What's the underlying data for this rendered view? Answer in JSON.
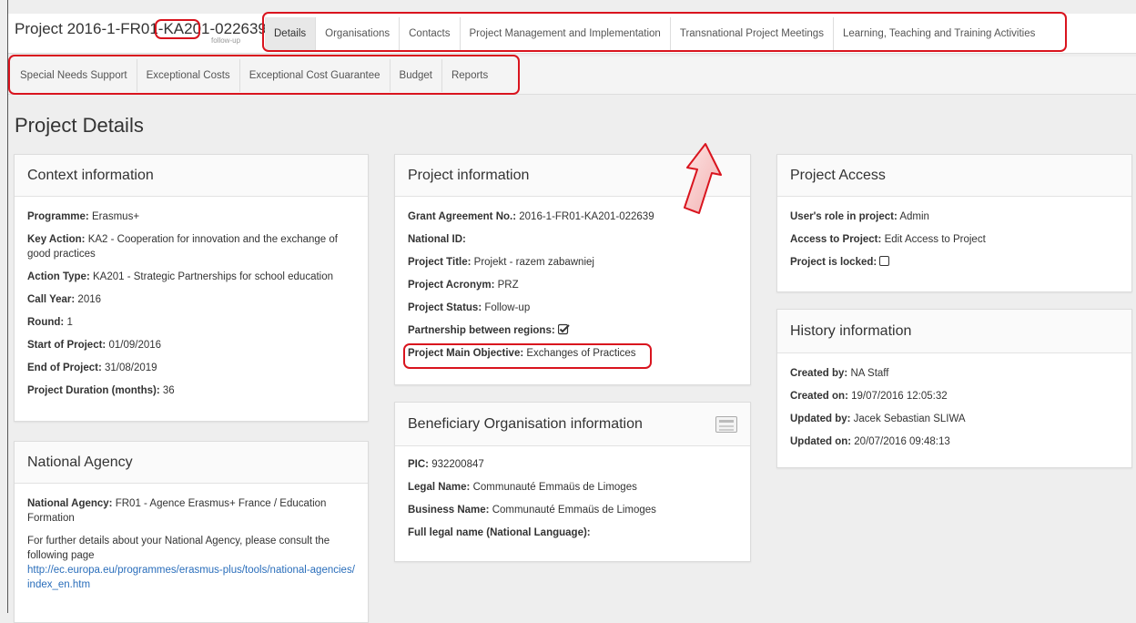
{
  "header": {
    "project_id": "Project 2016-1-FR01-KA201-022639",
    "status_sub": "follow-up"
  },
  "tabs_primary": [
    {
      "label": "Details"
    },
    {
      "label": "Organisations"
    },
    {
      "label": "Contacts"
    },
    {
      "label": "Project Management and Implementation"
    },
    {
      "label": "Transnational Project Meetings"
    },
    {
      "label": "Learning, Teaching and Training Activities"
    }
  ],
  "tabs_secondary": [
    {
      "label": "Special Needs Support"
    },
    {
      "label": "Exceptional Costs"
    },
    {
      "label": "Exceptional Cost Guarantee"
    },
    {
      "label": "Budget"
    },
    {
      "label": "Reports"
    }
  ],
  "page_title": "Project Details",
  "context": {
    "title": "Context information",
    "programme_label": "Programme:",
    "programme_value": "Erasmus+",
    "key_action_label": "Key Action:",
    "key_action_value": "KA2 - Cooperation for innovation and the exchange of good practices",
    "action_type_label": "Action Type:",
    "action_type_value": "KA201 - Strategic Partnerships for school education",
    "call_year_label": "Call Year:",
    "call_year_value": "2016",
    "round_label": "Round:",
    "round_value": "1",
    "start_label": "Start of Project:",
    "start_value": "01/09/2016",
    "end_label": "End of Project:",
    "end_value": "31/08/2019",
    "duration_label": "Project Duration (months):",
    "duration_value": "36"
  },
  "national_agency": {
    "title": "National Agency",
    "agency_label": "National Agency:",
    "agency_value": "FR01 - Agence Erasmus+ France / Education Formation",
    "details_text": "For further details about your National Agency, please consult the following page",
    "link": "http://ec.europa.eu/programmes/erasmus-plus/tools/national-agencies/index_en.htm"
  },
  "project_info": {
    "title": "Project information",
    "grant_label": "Grant Agreement No.:",
    "grant_value": "2016-1-FR01-KA201-022639",
    "national_id_label": "National ID:",
    "national_id_value": "",
    "title_label": "Project Title:",
    "title_value": "Projekt - razem zabawniej",
    "acronym_label": "Project Acronym:",
    "acronym_value": "PRZ",
    "status_label": "Project Status:",
    "status_value": "Follow-up",
    "partnership_label": "Partnership between regions:",
    "partnership_checked": true,
    "objective_label": "Project Main Objective:",
    "objective_value": "Exchanges of Practices"
  },
  "beneficiary": {
    "title": "Beneficiary Organisation information",
    "pic_label": "PIC:",
    "pic_value": "932200847",
    "legal_label": "Legal Name:",
    "legal_value": "Communauté Emmaüs de Limoges",
    "business_label": "Business Name:",
    "business_value": "Communauté Emmaüs de Limoges",
    "full_legal_label": "Full legal name (National Language):",
    "full_legal_value": ""
  },
  "access": {
    "title": "Project Access",
    "role_label": "User's role in project:",
    "role_value": "Admin",
    "access_label": "Access to Project:",
    "access_value": "Edit Access to Project",
    "locked_label": "Project is locked:",
    "locked_checked": false
  },
  "history": {
    "title": "History information",
    "created_by_label": "Created by:",
    "created_by_value": "NA Staff",
    "created_on_label": "Created on:",
    "created_on_value": "19/07/2016 12:05:32",
    "updated_by_label": "Updated by:",
    "updated_by_value": "Jacek Sebastian SLIWA",
    "updated_on_label": "Updated on:",
    "updated_on_value": "20/07/2016 09:48:13"
  },
  "colors": {
    "highlight": "#d9141e",
    "link": "#2a6ebb",
    "background": "#eeeeee"
  }
}
